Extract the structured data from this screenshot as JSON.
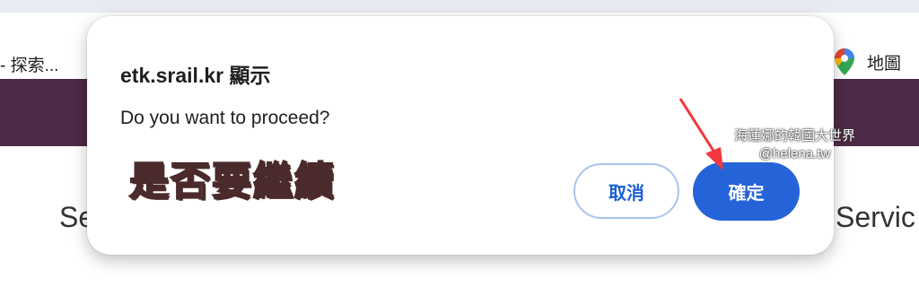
{
  "background": {
    "bookmark_left": "- 探索...",
    "bookmark_right_label": "地圖",
    "left_fragment": "Se",
    "right_fragment": "Servic"
  },
  "dialog": {
    "title": "etk.srail.kr 顯示",
    "message": "Do you want to proceed?",
    "cancel_label": "取消",
    "ok_label": "確定"
  },
  "annotation": {
    "text": "是否要繼續",
    "arrow_color": "#f0383c"
  },
  "watermark": {
    "line1": "海蓮娜的韓國大世界",
    "line2": "@helena.tw"
  },
  "colors": {
    "accent": "#2563d8",
    "band": "#4d2a45"
  }
}
